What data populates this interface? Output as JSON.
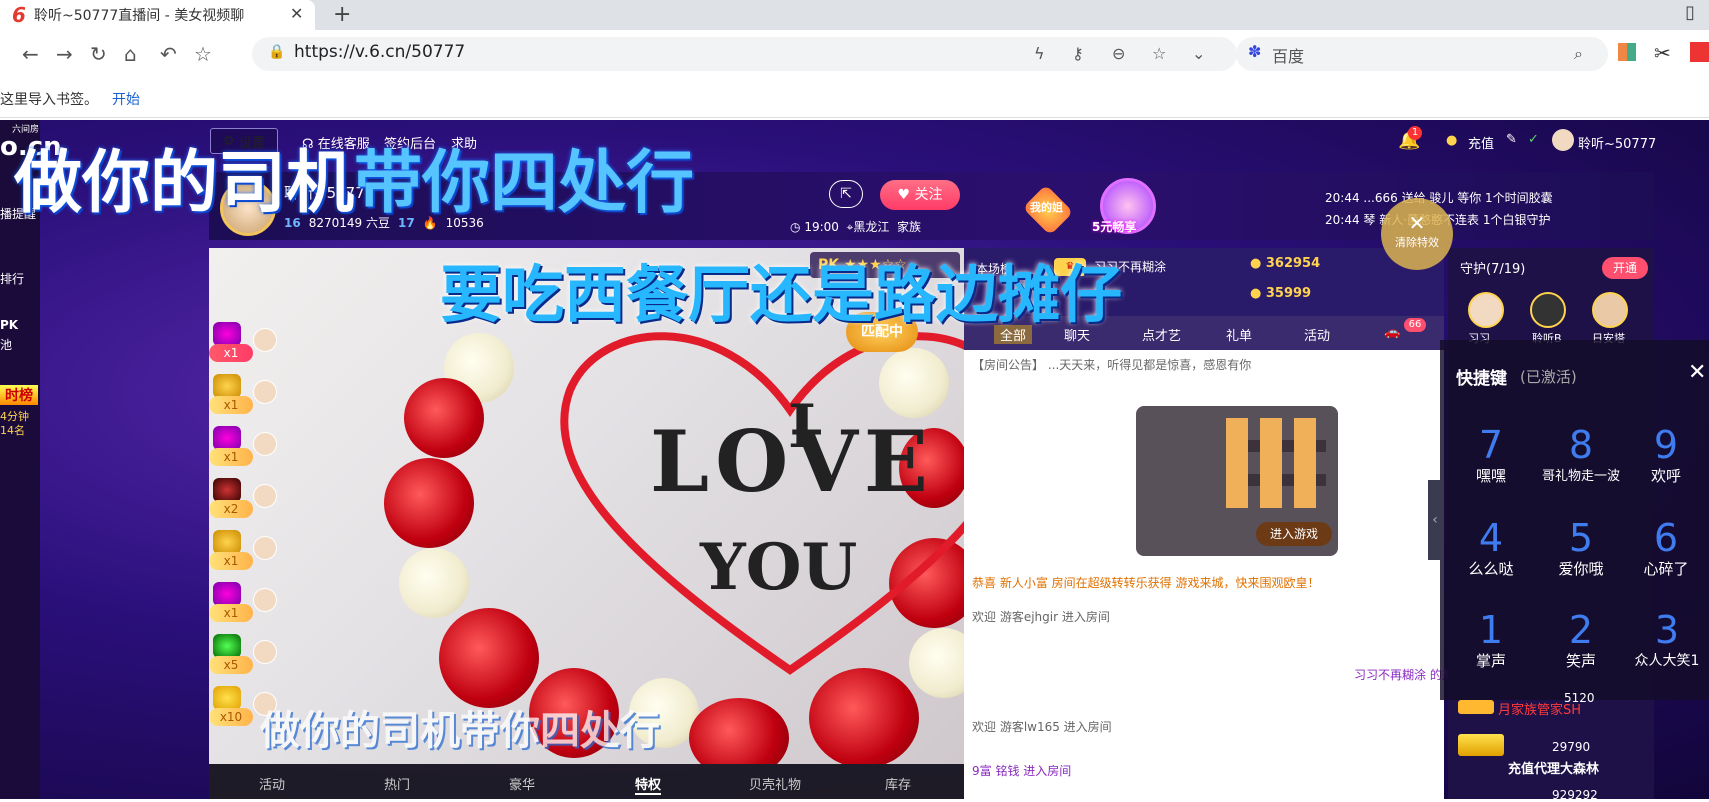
{
  "browser": {
    "tab_title": "聆听~50777直播间 - 美女视频聊",
    "tab_logo": "6",
    "url": "https://v.6.cn/50777",
    "search_placeholder": "百度",
    "bookmarks_text": "这里导入书签。",
    "bookmarks_link": "开始"
  },
  "site": {
    "logo": "o.cn",
    "logo_small": "六间房",
    "left_items": [
      "播提醒",
      "排行",
      "PK",
      "池"
    ],
    "hot_rank": "时榜",
    "hot_rank_time": "4分钟",
    "hot_rank_pos": "14名"
  },
  "topnav": {
    "settings": "设置",
    "items": [
      "在线客服",
      "签约后台",
      "求助"
    ],
    "notification_count": "1",
    "recharge": "充值",
    "user": "聆听~50777"
  },
  "room": {
    "anchor_name": "聆听~50777",
    "level": "16",
    "beans": "8270149 六豆",
    "fans_level": "17",
    "heat": "10536",
    "time": "19:00",
    "region": "黑龙江",
    "family": "家族",
    "follow": "关注",
    "fan_group": "我的姐",
    "promo": "5元畅享",
    "pk": "PK",
    "matching": "匹配中"
  },
  "broadcast": [
    {
      "time": "20:44",
      "text": "...666 送给 骏儿 等你 1个时间胶囊"
    },
    {
      "time": "20:44",
      "text": "琴 新人·菌憨憨不连表 1个白银守护"
    }
  ],
  "clear_effects": "清除特效",
  "rank": {
    "label": "本场榜",
    "top1_name": "习习不再糊涂",
    "top1_score": "362954",
    "top2_score": "35999"
  },
  "chat_tabs": [
    "全部",
    "聊天",
    "点才艺",
    "礼单",
    "活动"
  ],
  "chat_badge": "66",
  "chat_lines": [
    "【房间公告】 ...天天来，听得见都是惊喜，感恩有你",
    "恭喜 新人小富 房间在超级转转乐获得 游戏来城，快来围观欧皇！",
    "欢迎 游客ejhgir 进入房间",
    "习习不再糊涂 的热情支",
    "欢迎 游客lw165 进入房间",
    "9富 铭钱 进入房间"
  ],
  "game_button": "进入游戏",
  "gift_counts": [
    "x1",
    "x1",
    "x1",
    "x2",
    "x1",
    "x1",
    "x5",
    "x10"
  ],
  "video_tabs": [
    "活动",
    "热门",
    "豪华",
    "特权",
    "贝壳礼物",
    "库存"
  ],
  "video_tab_active": "特权",
  "video_text": {
    "i": "I",
    "love": "LOVE",
    "you": "YOU"
  },
  "guard": {
    "title": "守护(7/19)",
    "open": "开通",
    "names": [
      "习习",
      "聆听B",
      "日安塔"
    ]
  },
  "shortcut": {
    "title": "快捷键",
    "status": "(已激活)",
    "keys": [
      {
        "num": "7",
        "label": "嘿嘿"
      },
      {
        "num": "8",
        "label": "哥礼物走一波"
      },
      {
        "num": "9",
        "label": "欢呼"
      },
      {
        "num": "4",
        "label": "么么哒"
      },
      {
        "num": "5",
        "label": "爱你哦"
      },
      {
        "num": "6",
        "label": "心碎了"
      },
      {
        "num": "1",
        "label": "掌声"
      },
      {
        "num": "2",
        "label": "笑声"
      },
      {
        "num": "3",
        "label": "众人大笑1"
      }
    ]
  },
  "guard_list": [
    {
      "name": "月家族管家SH",
      "score": "5120"
    },
    {
      "name": "充值代理大森林",
      "score": "29790"
    },
    {
      "name": "",
      "score": "929292"
    }
  ],
  "captions": {
    "main_a": "做你的司机",
    "main_b": "带你四处行",
    "sub": "要吃西餐厅还是路边摊仔",
    "video": "做你的司机带你四处行"
  },
  "colors": {
    "accent_pink": "#ff3b67",
    "page_bg": "#2a0f7a",
    "caption_blue": "#27b7ff"
  }
}
